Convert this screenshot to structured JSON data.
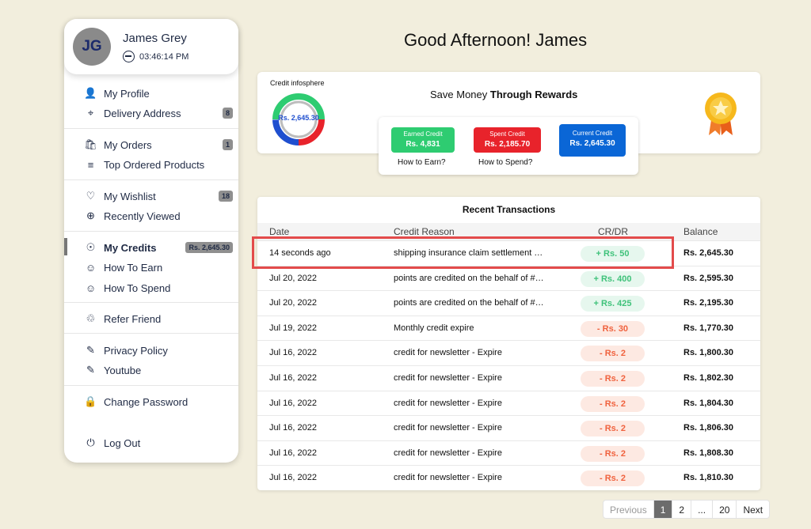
{
  "profile": {
    "initials": "JG",
    "name": "James Grey",
    "time": "03:46:14 PM"
  },
  "menu": [
    {
      "name": "my-profile",
      "icon": "user-icon",
      "glyph": "👤",
      "label": "My Profile",
      "badge": ""
    },
    {
      "name": "delivery-address",
      "icon": "location-pin-icon",
      "glyph": "⌖",
      "label": "Delivery Address",
      "badge": "8"
    },
    {
      "name": "my-orders",
      "icon": "shopping-bag-icon",
      "glyph": "🛍",
      "label": "My Orders",
      "badge": "1"
    },
    {
      "name": "top-ordered-products",
      "icon": "list-icon",
      "glyph": "≡",
      "label": "Top Ordered Products",
      "badge": ""
    },
    {
      "name": "my-wishlist",
      "icon": "heart-icon",
      "glyph": "♡",
      "label": "My Wishlist",
      "badge": "18"
    },
    {
      "name": "recently-viewed",
      "icon": "search-eye-icon",
      "glyph": "⊕",
      "label": "Recently Viewed",
      "badge": ""
    },
    {
      "name": "my-credits",
      "icon": "hand-coin-icon",
      "glyph": "☉",
      "label": "My Credits",
      "badge": "Rs. 2,645.30"
    },
    {
      "name": "how-to-earn",
      "icon": "earn-icon",
      "glyph": "☺",
      "label": "How To Earn",
      "badge": ""
    },
    {
      "name": "how-to-spend",
      "icon": "spend-icon",
      "glyph": "☺",
      "label": "How To Spend",
      "badge": ""
    },
    {
      "name": "refer-friend",
      "icon": "refer-icon",
      "glyph": "♲",
      "label": "Refer Friend",
      "badge": ""
    },
    {
      "name": "privacy-policy",
      "icon": "document-icon",
      "glyph": "✎",
      "label": "Privacy Policy",
      "badge": ""
    },
    {
      "name": "youtube",
      "icon": "document-icon",
      "glyph": "✎",
      "label": "Youtube",
      "badge": ""
    },
    {
      "name": "change-password",
      "icon": "lock-icon",
      "glyph": "🔒",
      "label": "Change Password",
      "badge": ""
    },
    {
      "name": "log-out",
      "icon": "power-icon",
      "glyph": "⏻",
      "label": "Log Out",
      "badge": ""
    }
  ],
  "greeting": "Good Afternoon! James",
  "rewards": {
    "infosphere_label": "Credit infosphere",
    "donut_value": "Rs. 2,645.30",
    "title_prefix": "Save Money ",
    "title_bold": "Through Rewards",
    "earned": {
      "label": "Earned Credit",
      "value": "Rs. 4,831",
      "color": "#2ecc71"
    },
    "spent": {
      "label": "Spent Credit",
      "value": "Rs. 2,185.70",
      "color": "#e8232b"
    },
    "current": {
      "label": "Current Credit",
      "value": "Rs. 2,645.30",
      "color": "#0a66d6"
    },
    "how_to_earn": "How to Earn?",
    "how_to_spend": "How to Spend?"
  },
  "transactions": {
    "title": "Recent Transactions",
    "columns": [
      "Date",
      "Credit Reason",
      "CR/DR",
      "Balance"
    ],
    "rows": [
      {
        "date": "14 seconds ago",
        "reason": "shipping insurance claim settlement …",
        "amount": "+ Rs. 50",
        "type": "cr",
        "balance": "Rs. 2,645.30"
      },
      {
        "date": "Jul 20, 2022",
        "reason": "points are credited on the behalf of #…",
        "amount": "+ Rs. 400",
        "type": "cr",
        "balance": "Rs. 2,595.30"
      },
      {
        "date": "Jul 20, 2022",
        "reason": "points are credited on the behalf of #…",
        "amount": "+ Rs. 425",
        "type": "cr",
        "balance": "Rs. 2,195.30"
      },
      {
        "date": "Jul 19, 2022",
        "reason": "Monthly credit expire",
        "amount": "- Rs. 30",
        "type": "dr",
        "balance": "Rs. 1,770.30"
      },
      {
        "date": "Jul 16, 2022",
        "reason": "credit for newsletter - Expire",
        "amount": "- Rs. 2",
        "type": "dr",
        "balance": "Rs. 1,800.30"
      },
      {
        "date": "Jul 16, 2022",
        "reason": "credit for newsletter - Expire",
        "amount": "- Rs. 2",
        "type": "dr",
        "balance": "Rs. 1,802.30"
      },
      {
        "date": "Jul 16, 2022",
        "reason": "credit for newsletter - Expire",
        "amount": "- Rs. 2",
        "type": "dr",
        "balance": "Rs. 1,804.30"
      },
      {
        "date": "Jul 16, 2022",
        "reason": "credit for newsletter - Expire",
        "amount": "- Rs. 2",
        "type": "dr",
        "balance": "Rs. 1,806.30"
      },
      {
        "date": "Jul 16, 2022",
        "reason": "credit for newsletter - Expire",
        "amount": "- Rs. 2",
        "type": "dr",
        "balance": "Rs. 1,808.30"
      },
      {
        "date": "Jul 16, 2022",
        "reason": "credit for newsletter - Expire",
        "amount": "- Rs. 2",
        "type": "dr",
        "balance": "Rs. 1,810.30"
      }
    ]
  },
  "pagination": {
    "previous": "Previous",
    "pages": [
      "1",
      "2",
      "...",
      "20"
    ],
    "current": "1",
    "next": "Next"
  }
}
